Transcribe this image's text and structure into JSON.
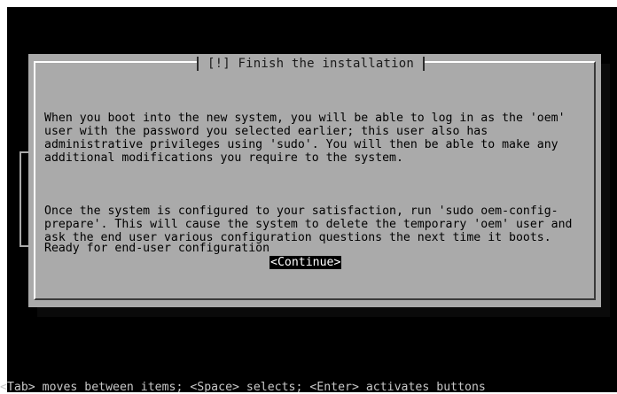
{
  "dialog": {
    "title": "[!] Finish the installation",
    "paragraphs": [
      "When you boot into the new system, you will be able to log in as the 'oem' user with the password you selected earlier; this user also has administrative privileges using 'sudo'. You will then be able to make any additional modifications you require to the system.",
      "Once the system is configured to your satisfaction, run 'sudo oem-config-prepare'. This will cause the system to delete the temporary 'oem' user and ask the end user various configuration questions the next time it boots."
    ],
    "ready_text": "Ready for end-user configuration",
    "continue_label": "<Continue>"
  },
  "footer": {
    "help": "<Tab> moves between items; <Space> selects; <Enter> activates buttons"
  },
  "colors": {
    "screen_bg": "#000000",
    "dialog_bg": "#aaaaaa",
    "button_bg": "#000000",
    "button_fg": "#ffffff"
  }
}
